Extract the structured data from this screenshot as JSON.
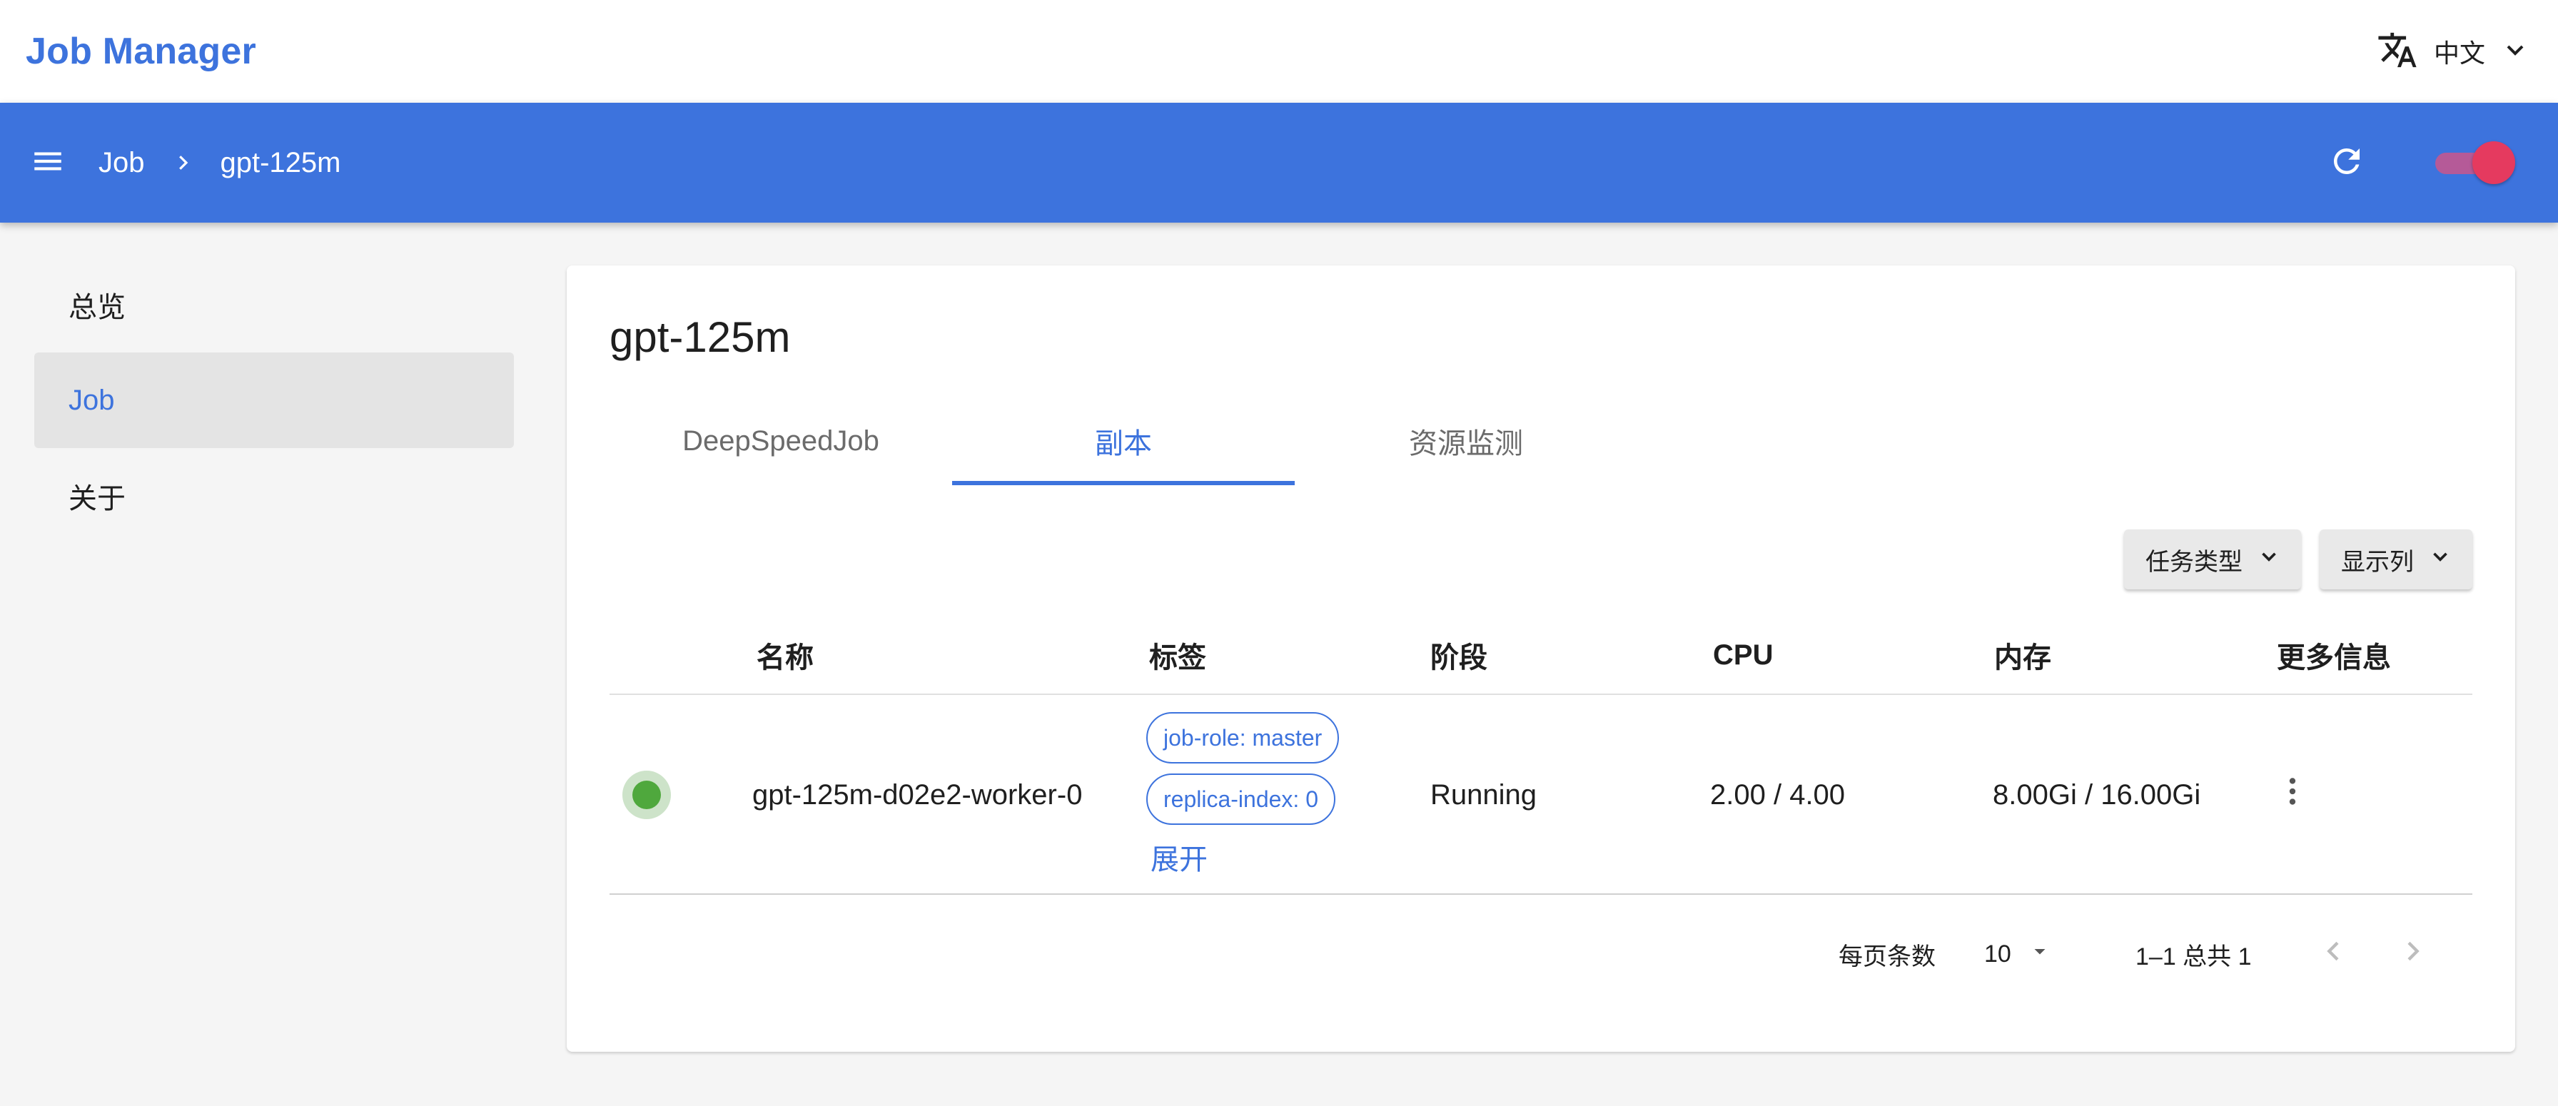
{
  "topbar": {
    "brand": "Job Manager",
    "language": {
      "label": "中文",
      "icon": "translate-icon",
      "chevron": "chevron-down-icon"
    }
  },
  "appbar": {
    "breadcrumb": [
      "Job",
      "gpt-125m"
    ],
    "menu_icon": "menu-icon",
    "refresh_icon": "refresh-icon",
    "toggle_on": true,
    "color": "#3d73dd"
  },
  "sidebar": {
    "items": [
      {
        "label": "总览",
        "active": false
      },
      {
        "label": "Job",
        "active": true
      },
      {
        "label": "关于",
        "active": false
      }
    ]
  },
  "main": {
    "title": "gpt-125m",
    "tabs": [
      {
        "label": "DeepSpeedJob",
        "active": false
      },
      {
        "label": "副本",
        "active": true
      },
      {
        "label": "资源监测",
        "active": false
      }
    ],
    "filters": [
      {
        "label": "任务类型"
      },
      {
        "label": "显示列"
      }
    ],
    "table": {
      "columns": [
        "名称",
        "标签",
        "阶段",
        "CPU",
        "内存",
        "更多信息"
      ],
      "rows": [
        {
          "status": "running",
          "name": "gpt-125m-d02e2-worker-0",
          "tags": [
            "job-role: master",
            "replica-index: 0"
          ],
          "expand": "展开",
          "phase": "Running",
          "cpu": "2.00 / 4.00",
          "memory": "8.00Gi / 16.00Gi"
        }
      ]
    },
    "pagination": {
      "rows_per_page_label": "每页条数",
      "rows_per_page": "10",
      "range": "1–1 总共 1"
    }
  },
  "colors": {
    "accent": "#3d73dd",
    "toggle": "#e53a5f",
    "status_running": "#4fa83d"
  }
}
